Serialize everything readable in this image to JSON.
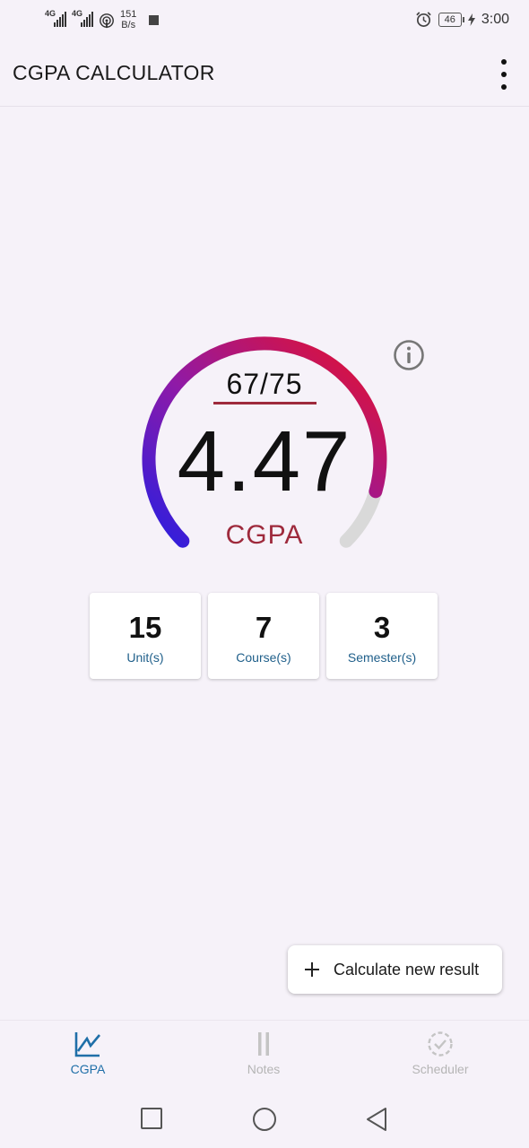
{
  "status_bar": {
    "network_1": "4G",
    "network_2": "4G",
    "speed_value": "151",
    "speed_unit": "B/s",
    "battery": "46",
    "time": "3:00"
  },
  "app_bar": {
    "title": "CGPA CALCULATOR",
    "menu_icon": "more-vert-icon"
  },
  "gauge": {
    "points_fraction": "67/75",
    "points_earned": 67,
    "points_total": 75,
    "cgpa_value": "4.47",
    "cgpa_label": "CGPA",
    "fill_fraction": 0.893,
    "gradient_start": "#2a1ee0",
    "gradient_end": "#e8102a",
    "track_color": "#d9d9d9",
    "accent": "#9e2a3c"
  },
  "info_icon": "info-icon",
  "stats": [
    {
      "value": "15",
      "label": "Unit(s)"
    },
    {
      "value": "7",
      "label": "Course(s)"
    },
    {
      "value": "3",
      "label": "Semester(s)"
    }
  ],
  "calculate_button": {
    "icon": "plus-icon",
    "label": "Calculate new result"
  },
  "bottom_nav": {
    "active_color": "#1f6fa8",
    "inactive_color": "#b5b5b5",
    "items": [
      {
        "label": "CGPA",
        "icon": "chart-line-icon",
        "active": true
      },
      {
        "label": "Notes",
        "icon": "notes-icon",
        "active": false
      },
      {
        "label": "Scheduler",
        "icon": "scheduler-check-icon",
        "active": false
      }
    ]
  },
  "system_nav": {
    "recent": "recent-apps-icon",
    "home": "home-icon",
    "back": "back-icon"
  }
}
